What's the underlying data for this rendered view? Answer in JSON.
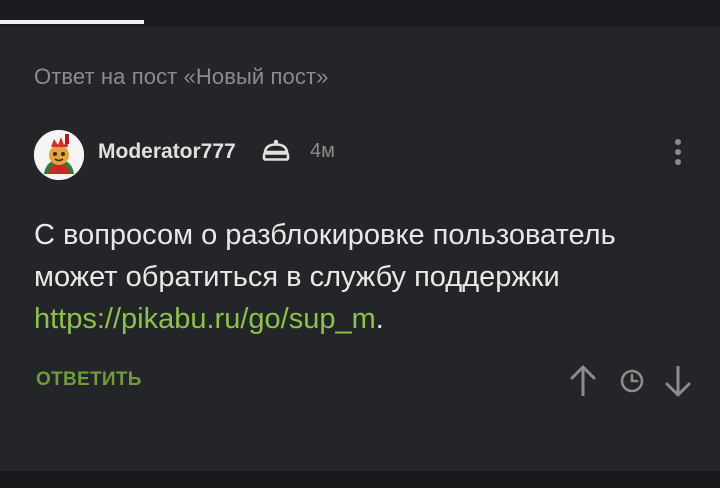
{
  "reply_context": "Ответ на пост «Новый пост»",
  "comment": {
    "author": "Moderator777",
    "time": "4м",
    "text_before_link": "С вопросом о разблокировке пользователь может обратиться в службу поддержки ",
    "link_text": "https://pikabu.ru/go/sup_m",
    "text_after_link": "."
  },
  "actions": {
    "reply_label": "ОТВЕТИТЬ"
  },
  "icons": {
    "moderator": "moderator-badge-icon",
    "more": "more-vertical-icon",
    "upvote": "arrow-up-icon",
    "history": "clock-icon",
    "downvote": "arrow-down-icon"
  },
  "colors": {
    "background": "#242528",
    "link": "#8bc34a",
    "reply_button": "#6f9a3d",
    "secondary_text": "#8c8c8c"
  }
}
